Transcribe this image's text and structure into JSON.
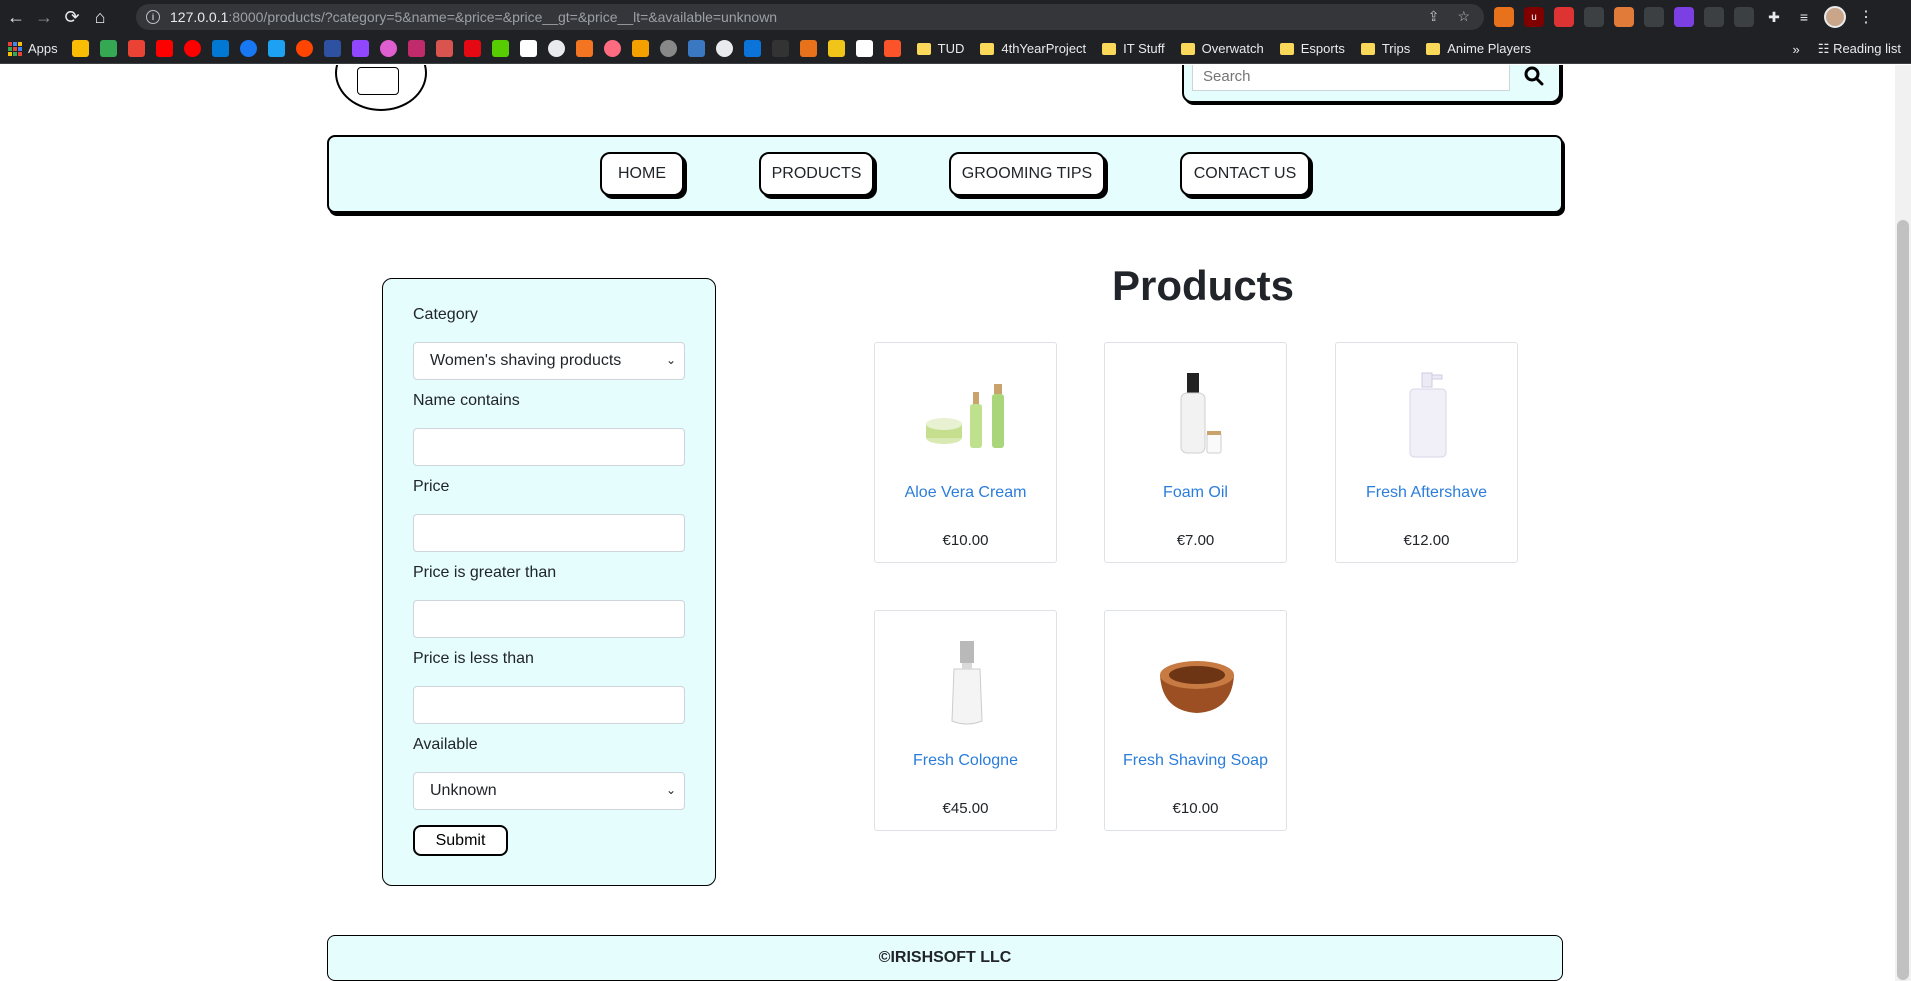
{
  "browser": {
    "url_host": "127.0.0.1",
    "url_rest": ":8000/products/?category=5&name=&price=&price__gt=&price__lt=&available=unknown",
    "bookmarks_apps": "Apps",
    "bookmark_folders": [
      "TUD",
      "4thYearProject",
      "IT Stuff",
      "Overwatch",
      "Esports",
      "Trips",
      "Anime Players"
    ],
    "reading_list": "Reading list",
    "more": "»"
  },
  "header": {
    "search_placeholder": "Search"
  },
  "nav": {
    "items": [
      "HOME",
      "PRODUCTS",
      "GROOMING TIPS",
      "CONTACT US"
    ]
  },
  "filters": {
    "category_label": "Category",
    "category_value": "Women's shaving products",
    "name_label": "Name contains",
    "price_label": "Price",
    "price_gt_label": "Price is greater than",
    "price_lt_label": "Price is less than",
    "available_label": "Available",
    "available_value": "Unknown",
    "submit_label": "Submit"
  },
  "main": {
    "title": "Products",
    "products": [
      {
        "name": "Aloe Vera Cream",
        "price": "€10.00",
        "icon": "cream-jar-and-bottles"
      },
      {
        "name": "Foam Oil",
        "price": "€7.00",
        "icon": "pump-bottle"
      },
      {
        "name": "Fresh Aftershave",
        "price": "€12.00",
        "icon": "clear-pump-bottle"
      },
      {
        "name": "Fresh Cologne",
        "price": "€45.00",
        "icon": "cologne-bottle"
      },
      {
        "name": "Fresh Shaving Soap",
        "price": "€10.00",
        "icon": "wooden-soap-bowl"
      }
    ]
  },
  "footer": {
    "text": "©IRISHSOFT LLC"
  }
}
